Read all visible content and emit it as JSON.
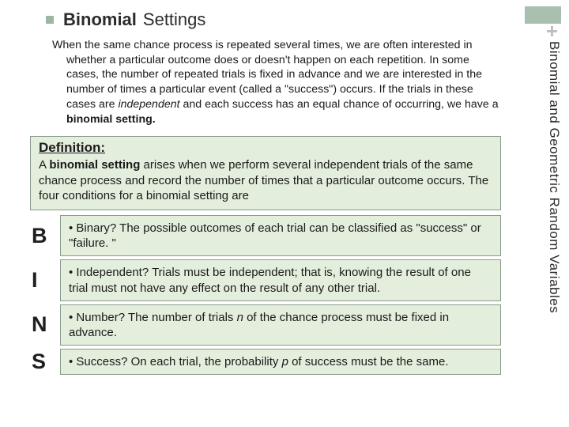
{
  "title": {
    "bold": "Binomial",
    "rest": "Settings"
  },
  "corner_plus": "+",
  "side_label": "Binomial and Geometric Random Variables",
  "intro": {
    "pre": "When the same chance process is repeated several times, we are often interested in whether a particular outcome does or doesn't happen on each repetition. In some cases, the number of repeated trials is fixed in advance and we are interested in the number of times a particular event (called a \"success\") occurs.  If the trials in these cases are ",
    "italic": "independent ",
    "mid": "and each success has an equal chance of occurring, we have a ",
    "bold_tail": "binomial setting."
  },
  "definition": {
    "heading": "Definition:",
    "lead_a": "A ",
    "lead_bold": "binomial setting",
    "lead_b": " arises when we perform several independent trials of the same chance process and record the number of times that a particular outcome occurs. The four conditions for a binomial setting are"
  },
  "bins": {
    "B": {
      "letter": "B",
      "text": "• Binary? The possible outcomes of each trial can be classified as \"success\" or \"failure. \""
    },
    "I": {
      "letter": "I",
      "text": "• Independent? Trials must be independent; that is, knowing the result of one trial must not have any effect on the result of any other trial."
    },
    "N": {
      "letter": "N",
      "pre": "• Number? The number of trials ",
      "it": "n",
      "post": " of the chance process must be fixed in advance."
    },
    "S": {
      "letter": "S",
      "pre": "• Success? On each trial, the probability ",
      "it": "p",
      "post": " of success must be the same."
    }
  }
}
